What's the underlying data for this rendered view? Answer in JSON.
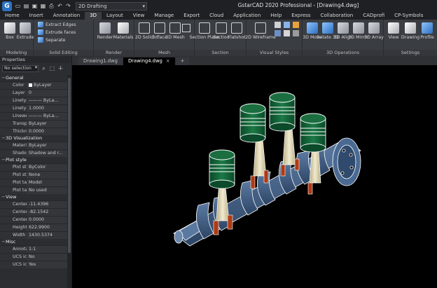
{
  "app": {
    "logo": "G",
    "title": "GstarCAD 2020 Professional - [Drawing4.dwg]",
    "workspace": "2D Drafting"
  },
  "quick_access": [
    "new-icon",
    "open-icon",
    "save-icon",
    "saveas-icon",
    "print-icon",
    "undo-icon",
    "redo-icon"
  ],
  "ribbon_tabs": [
    "Home",
    "Insert",
    "Annotation",
    "3D",
    "Layout",
    "View",
    "Manage",
    "Export",
    "Cloud",
    "Application",
    "Help",
    "Express",
    "Collaboration",
    "CADprofi",
    "CP-Symbols"
  ],
  "active_ribbon_tab": "3D",
  "ribbon": {
    "modeling": {
      "label": "Modeling",
      "box": "Box",
      "extrude": "Extrude"
    },
    "solid_editing": {
      "label": "Solid Editing",
      "extract_edges": "Extract Edges",
      "extrude_faces": "Extrude faces",
      "separate": "Separate"
    },
    "render": {
      "label": "Render",
      "render": "Render",
      "materials": "Materials"
    },
    "mesh": {
      "label": "Mesh",
      "solid2d": "2D Solid",
      "three_face": "3dface",
      "mesh3d": "3D Mesh"
    },
    "section": {
      "label": "Section",
      "section_plane": "Section Plane",
      "section": "Section",
      "flatshot": "Flatshot"
    },
    "visual_styles": {
      "label": "Visual Styles",
      "wireframe2d": "2D Wireframe"
    },
    "operations": {
      "label": "3D Operations",
      "move": "3D Move",
      "rotate": "Rotate 3D",
      "align": "3D Align",
      "mirror": "3D Mirror",
      "array": "3D Array"
    },
    "settings": {
      "label": "Settings",
      "view": "View",
      "drawing": "Drawing",
      "profile": "Profile"
    }
  },
  "properties": {
    "title": "Properties",
    "selection": "No selection",
    "sections": [
      {
        "name": "General",
        "rows": [
          {
            "k": "Color",
            "v": "ByLayer",
            "swatch": true
          },
          {
            "k": "Layer",
            "v": "0"
          },
          {
            "k": "Linetype",
            "v": "——— ByLa..."
          },
          {
            "k": "Linetype...",
            "v": "1.0000"
          },
          {
            "k": "Linewei...",
            "v": "——— ByLa..."
          },
          {
            "k": "Transpa...",
            "v": "ByLayer"
          },
          {
            "k": "Thickne...",
            "v": "0.0000"
          }
        ]
      },
      {
        "name": "3D Visualization",
        "rows": [
          {
            "k": "Material",
            "v": "ByLayer"
          },
          {
            "k": "Shadow...",
            "v": "Shadow and r..."
          }
        ]
      },
      {
        "name": "Plot style",
        "rows": [
          {
            "k": "Plot style",
            "v": "ByColor"
          },
          {
            "k": "Plot styl...",
            "v": "None"
          },
          {
            "k": "Plot tabl...",
            "v": "Model"
          },
          {
            "k": "Plot tabl...",
            "v": "No used"
          }
        ]
      },
      {
        "name": "View",
        "rows": [
          {
            "k": "Center X",
            "v": "-11.4396"
          },
          {
            "k": "Center Y",
            "v": "-82.1542"
          },
          {
            "k": "Center Z",
            "v": "0.0000"
          },
          {
            "k": "Height",
            "v": "622.9900"
          },
          {
            "k": "Width",
            "v": "1430.5374"
          }
        ]
      },
      {
        "name": "Misc",
        "rows": [
          {
            "k": "Annotati...",
            "v": "1:1"
          },
          {
            "k": "UCS ico...",
            "v": "No"
          },
          {
            "k": "UCS ico...",
            "v": "Yes"
          }
        ]
      }
    ]
  },
  "doc_tabs": [
    {
      "label": "Drawing1.dwg",
      "active": false
    },
    {
      "label": "Drawing4.dwg",
      "active": true
    }
  ],
  "colors": {
    "piston": "#0e5a32",
    "crank": "#3f587a",
    "rod": "#d9cfa6",
    "bearing": "#b03a14",
    "canvas": "#000000"
  }
}
